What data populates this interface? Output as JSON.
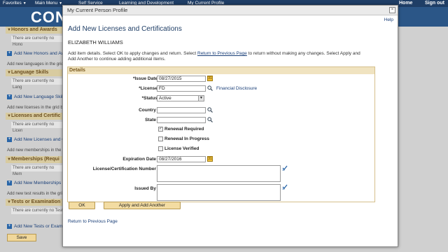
{
  "background": {
    "nav": {
      "favorites": "Favorites",
      "main_menu": "Main Menu",
      "self_service": "Self Service",
      "learning": "Learning and Development",
      "profile": "My Current Profile",
      "home": "Home",
      "sign_out": "Sign out"
    },
    "logo": "CONN",
    "sections": [
      {
        "header": "Honors and Awards",
        "empty": "There are currently no Hono",
        "add": "Add New Honors and Awa",
        "note": "Add new languages in the grid"
      },
      {
        "header": "Language Skills",
        "empty": "There are currently no Lang",
        "add": "Add New Language Skills",
        "note": "Add new licenses in the grid b"
      },
      {
        "header": "Licenses and Certific",
        "empty": "There are currently no Licen",
        "add": "Add New Licenses and Ce",
        "note": "Add new memberships in the"
      },
      {
        "header": "Memberships (Requi",
        "empty": "There are currently no Mem",
        "add": "Add New Memberships",
        "note": "Add new test results in the gri"
      },
      {
        "header": "Tests or Examination",
        "empty": "There are currently no Test",
        "add": "Add New Tests or Exami",
        "note": ""
      }
    ],
    "save": "Save"
  },
  "modal": {
    "title": "My Current Person Profile",
    "close": "×",
    "help": "Help",
    "heading": "Add New Licenses and Certifications",
    "person_name": "ELIZABETH WILLIAMS",
    "instructions": {
      "before": "Add item details. Select OK to apply changes and return. Select ",
      "link": "Return to Previous Page",
      "after": " to return without making any changes. Select Apply and Add Another to continue adding additional items."
    },
    "details_header": "Details",
    "fields": {
      "issue_date": {
        "label": "*Issue Date",
        "value": "08/27/2015"
      },
      "license": {
        "label": "*License",
        "value": "FD",
        "link": "Financial Disclosure"
      },
      "status": {
        "label": "*Status",
        "value": "Active"
      },
      "country": {
        "label": "Country",
        "value": ""
      },
      "state": {
        "label": "State",
        "value": ""
      },
      "renewal_required": {
        "label": "Renewal Required",
        "checked": true
      },
      "renewal_in_progress": {
        "label": "Renewal In Progress",
        "checked": false
      },
      "license_verified": {
        "label": "License Verified",
        "checked": false
      },
      "expiration_date": {
        "label": "Expiration Date",
        "value": "08/27/2016"
      },
      "license_number": {
        "label": "License/Certification Number",
        "value": ""
      },
      "issued_by": {
        "label": "Issued By",
        "value": ""
      }
    },
    "buttons": {
      "ok": "OK",
      "apply_add": "Apply and Add Another"
    },
    "return_link": "Return to Previous Page"
  },
  "colors": {
    "header_bg": "#1f3e66",
    "link": "#1a3f78",
    "button_bg": "#f3dca2",
    "section_header_bg": "#f0e3c0"
  }
}
